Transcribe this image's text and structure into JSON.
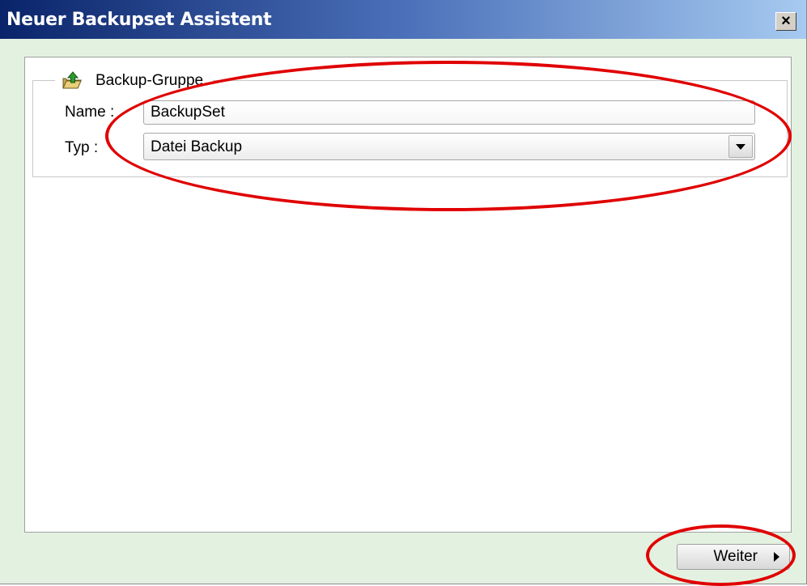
{
  "window": {
    "title": "Neuer Backupset Assistent"
  },
  "titlebar": {
    "close_label": "×",
    "close_icon": "close-icon"
  },
  "group": {
    "legend": "Backup-Gruppe",
    "icon": "folder-upload-icon",
    "name_label": "Name :",
    "name_value": "BackupSet",
    "type_label": "Typ :",
    "type_value": "Datei Backup"
  },
  "footer": {
    "next_label": "Weiter"
  },
  "colors": {
    "title_gradient_start": "#0a246a",
    "title_gradient_end": "#a6caf0",
    "window_background": "#e3f1e1",
    "annotation": "#e00000"
  }
}
